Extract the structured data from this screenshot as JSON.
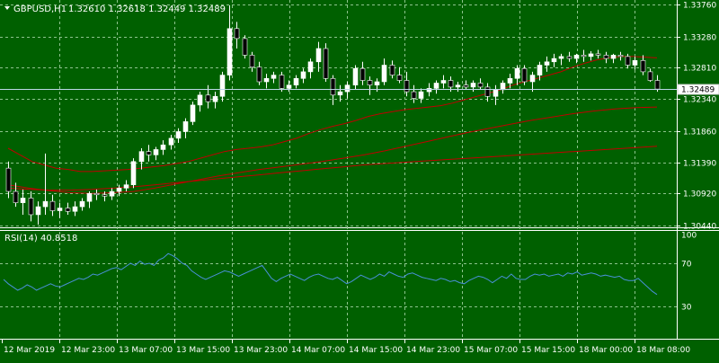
{
  "header": {
    "symbol": "GBPUSD,H1",
    "ohlc": "1.32610 1.32618 1.32449 1.32489"
  },
  "colors": {
    "background": "#006000",
    "grid": "#8cc48c",
    "bull": "#ffffff",
    "bear": "#000000",
    "ma": "#c00000",
    "rsi": "#4a90d9",
    "price_line": "#bcd8e8",
    "axis": "#ffffff"
  },
  "price_axis": {
    "ticks": [
      "1.33760",
      "1.33280",
      "1.32810",
      "1.32340",
      "1.31860",
      "1.31390",
      "1.30920",
      "1.30440"
    ],
    "current_label": "1.32489"
  },
  "rsi_panel": {
    "label": "RSI(14) 40.8518",
    "levels": [
      "100",
      "70",
      "30"
    ]
  },
  "time_axis": {
    "labels": [
      "12 Mar 2019",
      "12 Mar 23:00",
      "13 Mar 07:00",
      "13 Mar 15:00",
      "13 Mar 23:00",
      "14 Mar 07:00",
      "14 Mar 15:00",
      "14 Mar 23:00",
      "15 Mar 07:00",
      "15 Mar 15:00",
      "18 Mar 00:00",
      "18 Mar 08:00"
    ]
  },
  "chart_data": {
    "type": "candlestick",
    "price_range": [
      1.3041,
      1.3383
    ],
    "rsi_range": [
      0,
      100
    ],
    "candles": [
      [
        1.313,
        1.314,
        1.3085,
        1.3095
      ],
      [
        1.3095,
        1.3108,
        1.3072,
        1.3078
      ],
      [
        1.3078,
        1.3098,
        1.306,
        1.3085
      ],
      [
        1.3085,
        1.3095,
        1.305,
        1.306
      ],
      [
        1.306,
        1.308,
        1.3045,
        1.3072
      ],
      [
        1.3072,
        1.3152,
        1.306,
        1.308
      ],
      [
        1.308,
        1.309,
        1.3058,
        1.3066
      ],
      [
        1.3066,
        1.3078,
        1.3055,
        1.307
      ],
      [
        1.307,
        1.3078,
        1.306,
        1.3065
      ],
      [
        1.3065,
        1.308,
        1.3058,
        1.3072
      ],
      [
        1.3072,
        1.3085,
        1.3066,
        1.308
      ],
      [
        1.308,
        1.3095,
        1.307,
        1.3092
      ],
      [
        1.3092,
        1.3098,
        1.3082,
        1.309
      ],
      [
        1.309,
        1.3095,
        1.308,
        1.3088
      ],
      [
        1.3088,
        1.31,
        1.3082,
        1.3095
      ],
      [
        1.3095,
        1.3105,
        1.3088,
        1.31
      ],
      [
        1.31,
        1.3112,
        1.3095,
        1.3105
      ],
      [
        1.3105,
        1.3145,
        1.31,
        1.314
      ],
      [
        1.314,
        1.316,
        1.3128,
        1.3155
      ],
      [
        1.3155,
        1.3165,
        1.314,
        1.315
      ],
      [
        1.315,
        1.3162,
        1.3142,
        1.3158
      ],
      [
        1.3158,
        1.3172,
        1.315,
        1.3165
      ],
      [
        1.3165,
        1.318,
        1.3158,
        1.3175
      ],
      [
        1.3175,
        1.319,
        1.3168,
        1.3185
      ],
      [
        1.3185,
        1.3205,
        1.3175,
        1.32
      ],
      [
        1.32,
        1.323,
        1.3195,
        1.3225
      ],
      [
        1.3225,
        1.3245,
        1.3215,
        1.324
      ],
      [
        1.324,
        1.3255,
        1.322,
        1.323
      ],
      [
        1.323,
        1.3245,
        1.322,
        1.3238
      ],
      [
        1.3238,
        1.3275,
        1.323,
        1.327
      ],
      [
        1.327,
        1.3375,
        1.3262,
        1.334
      ],
      [
        1.334,
        1.335,
        1.331,
        1.3325
      ],
      [
        1.3325,
        1.333,
        1.3295,
        1.33
      ],
      [
        1.33,
        1.3305,
        1.3275,
        1.3282
      ],
      [
        1.3282,
        1.329,
        1.3255,
        1.326
      ],
      [
        1.326,
        1.3272,
        1.325,
        1.3265
      ],
      [
        1.3265,
        1.3275,
        1.3258,
        1.327
      ],
      [
        1.327,
        1.3275,
        1.3245,
        1.325
      ],
      [
        1.325,
        1.3262,
        1.3245,
        1.3255
      ],
      [
        1.3255,
        1.327,
        1.325,
        1.3265
      ],
      [
        1.3265,
        1.328,
        1.3258,
        1.3275
      ],
      [
        1.3275,
        1.3295,
        1.3265,
        1.329
      ],
      [
        1.329,
        1.332,
        1.3275,
        1.331
      ],
      [
        1.331,
        1.3318,
        1.326,
        1.3265
      ],
      [
        1.3265,
        1.327,
        1.3225,
        1.324
      ],
      [
        1.324,
        1.3255,
        1.323,
        1.3245
      ],
      [
        1.3245,
        1.326,
        1.3235,
        1.3255
      ],
      [
        1.3255,
        1.3285,
        1.3248,
        1.328
      ],
      [
        1.328,
        1.329,
        1.3255,
        1.3262
      ],
      [
        1.3262,
        1.3268,
        1.324,
        1.3255
      ],
      [
        1.3255,
        1.3265,
        1.3245,
        1.326
      ],
      [
        1.326,
        1.3295,
        1.3255,
        1.3285
      ],
      [
        1.3285,
        1.3292,
        1.3265,
        1.327
      ],
      [
        1.327,
        1.3282,
        1.3258,
        1.3262
      ],
      [
        1.3262,
        1.3275,
        1.3238,
        1.3245
      ],
      [
        1.3245,
        1.3255,
        1.3228,
        1.3235
      ],
      [
        1.3235,
        1.325,
        1.3228,
        1.3245
      ],
      [
        1.3245,
        1.3258,
        1.3238,
        1.325
      ],
      [
        1.325,
        1.3262,
        1.3242,
        1.3258
      ],
      [
        1.3258,
        1.327,
        1.325,
        1.3262
      ],
      [
        1.3262,
        1.3268,
        1.3245,
        1.3252
      ],
      [
        1.3252,
        1.326,
        1.3245,
        1.3255
      ],
      [
        1.3255,
        1.3262,
        1.3248,
        1.3252
      ],
      [
        1.3252,
        1.3262,
        1.3245,
        1.3258
      ],
      [
        1.3258,
        1.3265,
        1.3248,
        1.3252
      ],
      [
        1.3252,
        1.3258,
        1.323,
        1.3238
      ],
      [
        1.3238,
        1.3255,
        1.3225,
        1.3248
      ],
      [
        1.3248,
        1.3262,
        1.3242,
        1.3258
      ],
      [
        1.3258,
        1.3272,
        1.325,
        1.3265
      ],
      [
        1.3265,
        1.3285,
        1.3255,
        1.328
      ],
      [
        1.328,
        1.3285,
        1.3255,
        1.326
      ],
      [
        1.326,
        1.3275,
        1.3245,
        1.327
      ],
      [
        1.327,
        1.329,
        1.3262,
        1.3285
      ],
      [
        1.3285,
        1.3298,
        1.3275,
        1.329
      ],
      [
        1.329,
        1.3302,
        1.3282,
        1.3295
      ],
      [
        1.3295,
        1.3302,
        1.3285,
        1.3298
      ],
      [
        1.3298,
        1.3305,
        1.329,
        1.3295
      ],
      [
        1.3295,
        1.3302,
        1.3288,
        1.33
      ],
      [
        1.33,
        1.3308,
        1.329,
        1.3298
      ],
      [
        1.3298,
        1.3306,
        1.3292,
        1.3302
      ],
      [
        1.3302,
        1.3308,
        1.3295,
        1.33
      ],
      [
        1.33,
        1.3305,
        1.3288,
        1.3295
      ],
      [
        1.3295,
        1.3302,
        1.3288,
        1.33
      ],
      [
        1.33,
        1.3305,
        1.3292,
        1.3298
      ],
      [
        1.3298,
        1.3302,
        1.328,
        1.3285
      ],
      [
        1.3285,
        1.3298,
        1.3278,
        1.3292
      ],
      [
        1.3292,
        1.33,
        1.327,
        1.3275
      ],
      [
        1.3275,
        1.328,
        1.326,
        1.3262
      ],
      [
        1.3262,
        1.327,
        1.3245,
        1.3249
      ]
    ],
    "ma_series": [
      [
        1.316,
        1.315,
        1.314,
        1.3135,
        1.313,
        1.3128,
        1.3125,
        1.3125,
        1.3126,
        1.3127,
        1.3128,
        1.313,
        1.3132,
        1.3134,
        1.3137,
        1.314,
        1.3145,
        1.315,
        1.3155,
        1.3158,
        1.316,
        1.3162,
        1.3165,
        1.317,
        1.3175,
        1.3182,
        1.3188,
        1.3193,
        1.3197,
        1.3202,
        1.3208,
        1.3212,
        1.3215,
        1.3218,
        1.322,
        1.3222,
        1.3224,
        1.3228,
        1.3233,
        1.3238,
        1.3243,
        1.3248,
        1.3255,
        1.326,
        1.3265,
        1.327,
        1.3275,
        1.3282,
        1.3288,
        1.3293,
        1.3296,
        1.3298,
        1.3298,
        1.3297,
        1.3296
      ],
      [
        1.3105,
        1.31,
        1.3096,
        1.3093,
        1.3092,
        1.3093,
        1.3095,
        1.31,
        1.3106,
        1.3112,
        1.3118,
        1.3123,
        1.3128,
        1.3132,
        1.3136,
        1.314,
        1.3145,
        1.315,
        1.3156,
        1.3163,
        1.317,
        1.3177,
        1.3184,
        1.319,
        1.3196,
        1.3202,
        1.3207,
        1.3212,
        1.3216,
        1.3219,
        1.3221,
        1.3222
      ],
      [
        1.31,
        1.3098,
        1.3097,
        1.3097,
        1.3098,
        1.31,
        1.3102,
        1.3105,
        1.3108,
        1.3111,
        1.3114,
        1.3117,
        1.312,
        1.3123,
        1.3126,
        1.3129,
        1.3132,
        1.3135,
        1.3137,
        1.3139,
        1.3141,
        1.3143,
        1.3145,
        1.3147,
        1.3149,
        1.3151,
        1.3153,
        1.3155,
        1.3157,
        1.3159,
        1.3161,
        1.3163
      ]
    ],
    "rsi": [
      55,
      51,
      48,
      45,
      47,
      50,
      48,
      45,
      47,
      49,
      51,
      49,
      48,
      50,
      52,
      54,
      56,
      55,
      57,
      60,
      59,
      61,
      63,
      65,
      66,
      64,
      67,
      70,
      68,
      72,
      69,
      70,
      68,
      73,
      75,
      79,
      77,
      74,
      70,
      68,
      63,
      60,
      57,
      55,
      57,
      59,
      61,
      63,
      62,
      60,
      58,
      60,
      62,
      64,
      66,
      68,
      62,
      56,
      53,
      56,
      58,
      60,
      58,
      56,
      54,
      57,
      59,
      60,
      58,
      56,
      55,
      57,
      54,
      51,
      53,
      56,
      59,
      57,
      55,
      57,
      60,
      58,
      62,
      60,
      58,
      57,
      60,
      61,
      59,
      57,
      56,
      55,
      54,
      56,
      55,
      53,
      54,
      52,
      51,
      54,
      56,
      58,
      57,
      55,
      52,
      55,
      58,
      56,
      60,
      56,
      55,
      55,
      58,
      60,
      59,
      60,
      58,
      59,
      60,
      58,
      61,
      60,
      62,
      59,
      60,
      61,
      60,
      58,
      59,
      58,
      57,
      58,
      55,
      54,
      54,
      56,
      52,
      48,
      44,
      41
    ]
  }
}
